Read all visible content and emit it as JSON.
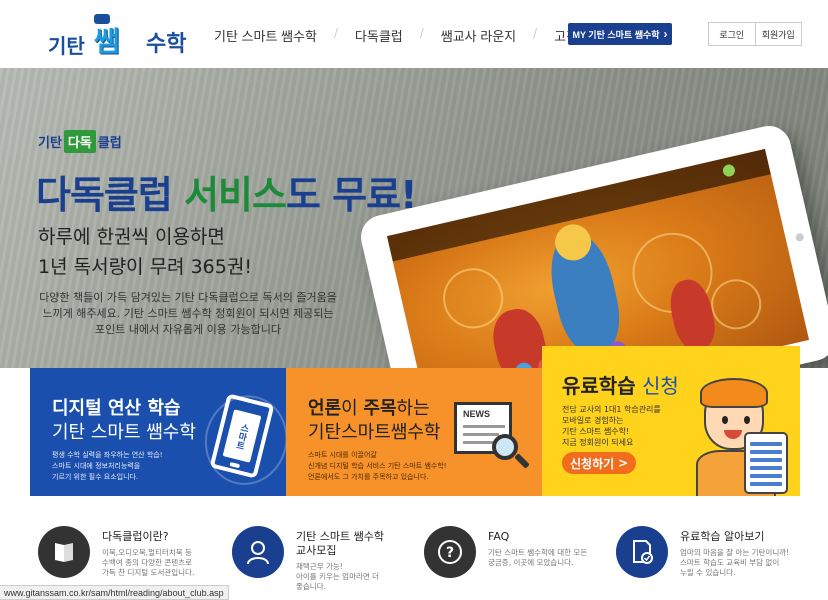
{
  "header": {
    "logo": {
      "part1": "기탄",
      "part2": "쌤",
      "part3": "수학"
    },
    "nav": [
      "기탄 스마트 쌤수학",
      "다독클럽",
      "쌤교사 라운지",
      "고객센터"
    ],
    "my_button": "MY 기탄 스마트 쌤수학",
    "login": "로그인",
    "signup": "회원가입"
  },
  "hero": {
    "club_logo": {
      "a": "기탄",
      "b": "다독",
      "c": "클럽"
    },
    "title": {
      "a": "다독클럽 ",
      "b": "서비스",
      "c": "도 무료!"
    },
    "sub1": "하루에 한권씩 이용하면",
    "sub2": "1년 독서량이 무려 365권!",
    "desc1": "다양한 책들이 가득 담겨있는 기탄 다독클럽으로 독서의 즐거움을",
    "desc2": "느끼게 해주세요. 기탄 스마트 쌤수학 정회원이 되시면 제공되는",
    "desc3": "포인트 내에서 자유롭게 이용 가능합니다"
  },
  "tiles": {
    "t1": {
      "h1": "디지털 연산 학습",
      "h2": "기탄 스마트 쌤수학",
      "d1": "평생 수학 실력을 좌우하는 연산 학습!",
      "d2": "스마트 시대에 정보처리능력을",
      "d3": "기르기 위한 필수 요소입니다.",
      "icon_text": "스마트"
    },
    "t2": {
      "h1a": "언론",
      "h1b": "이 ",
      "h1c": "주목",
      "h1d": "하는",
      "h2": "기탄스마트쌤수학",
      "d1": "스마트 시대를 이끌어갈",
      "d2": "신개념 디지털 학습 서비스 기탄 스마트 쌤수학!",
      "d3": "언론에서도 그 가치를 주목하고 있습니다.",
      "news": "NEWS"
    },
    "t3": {
      "h1a": "유료학습",
      "h1b": " 신청",
      "d1": "전담 교사의 1대1 학습관리를",
      "d2": "모바일로 경험하는",
      "d3": "기탄 스마트 쌤수학!",
      "d4": "지금 정회원이 되세요",
      "cta": "신청하기",
      "cta_arrow": ">"
    }
  },
  "features": [
    {
      "title": "다독클럽이란?",
      "desc1": "이북,오디오북,멀티터치북 등",
      "desc2": "수백여 종의 다양한 콘텐츠로",
      "desc3": "가득 찬 디지털 도서관입니다.",
      "icon": "book-icon"
    },
    {
      "title": "기탄 스마트 쌤수학",
      "title2": "교사모집",
      "desc1": "재택근무 가능!",
      "desc2": "아이를 키우는 엄마라면 더",
      "desc3": "좋습니다.",
      "icon": "teacher-icon"
    },
    {
      "title": "FAQ",
      "desc1": "기탄 스마트 쌤수학에 대한 모든",
      "desc2": "궁금증, 이곳에 모았습니다.",
      "icon": "question-icon"
    },
    {
      "title": "유료학습 알아보기",
      "desc1": "엄마의 마음을 잘 아는 기탄이니까!",
      "desc2": "스마트 학습도 교육비 부담 없이",
      "desc3": "누릴 수 있습니다.",
      "icon": "document-check-icon"
    }
  ],
  "status_url": "www.gitanssam.co.kr/sam/html/reading/about_club.asp",
  "colors": {
    "brand_blue": "#1a3f8f",
    "green": "#1d8a3a",
    "tile_blue": "#1b4fad",
    "tile_orange": "#f7922a",
    "tile_yellow": "#ffd21c",
    "cta_orange": "#f26c1e"
  }
}
